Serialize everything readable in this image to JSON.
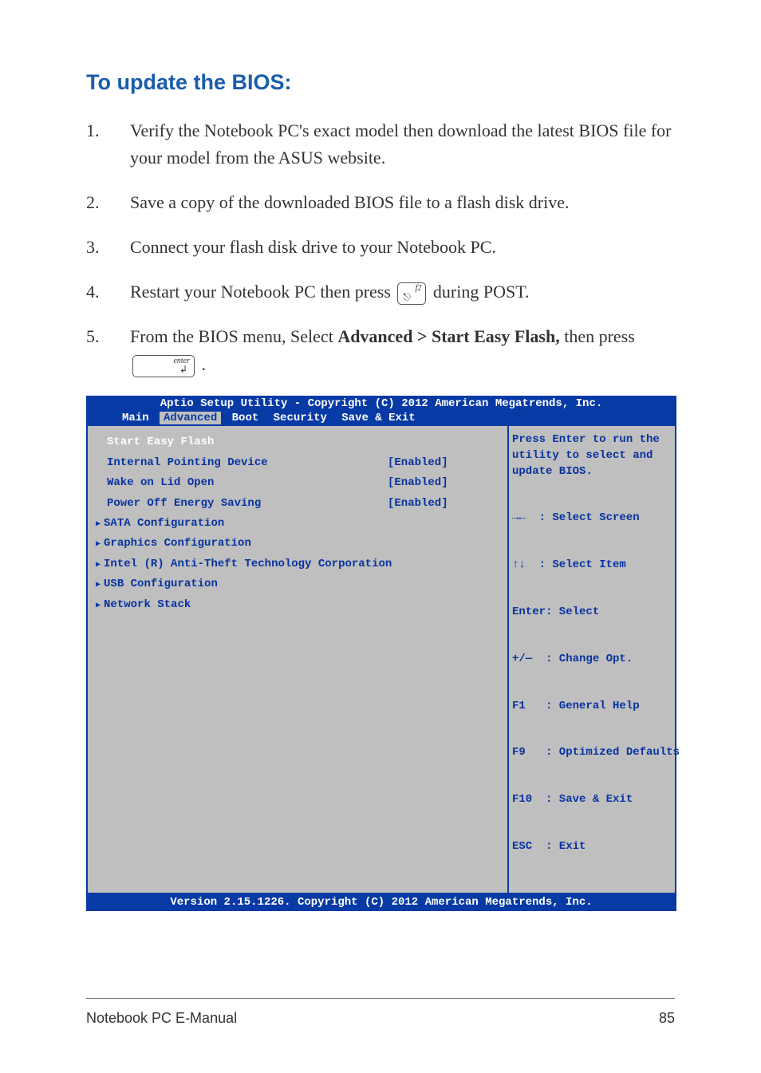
{
  "heading": "To update the BIOS:",
  "steps": {
    "s1": {
      "num": "1.",
      "text": "Verify the Notebook PC's exact model then download the latest BIOS file for your model from the ASUS website."
    },
    "s2": {
      "num": "2.",
      "text": "Save a copy of the downloaded BIOS file to a flash disk drive."
    },
    "s3": {
      "num": "3.",
      "text": "Connect your flash disk drive to your Notebook PC."
    },
    "s4": {
      "num": "4.",
      "pre": "Restart your Notebook PC then press ",
      "post": " during POST."
    },
    "s5": {
      "num": "5.",
      "pre": "From the BIOS menu, Select ",
      "bold": "Advanced > Start Easy Flash,",
      "mid": " then press ",
      "post": "."
    }
  },
  "key_f2_label": "f2",
  "key_f2_sym": "📶",
  "key_enter_label": "enter",
  "key_enter_sym": "↵",
  "bios": {
    "header": "Aptio Setup Utility - Copyright (C) 2012 American Megatrends, Inc.",
    "tabs": [
      "Main",
      "Advanced",
      "Boot",
      "Security",
      "Save & Exit"
    ],
    "active_tab_index": 1,
    "rows": [
      {
        "label": "Start Easy Flash",
        "value": "",
        "selected": true,
        "arrow": false
      },
      {
        "label": "Internal Pointing Device",
        "value": "[Enabled]",
        "selected": false,
        "arrow": false
      },
      {
        "label": "Wake on Lid Open",
        "value": "[Enabled]",
        "selected": false,
        "arrow": false
      },
      {
        "label": "Power Off Energy Saving",
        "value": "[Enabled]",
        "selected": false,
        "arrow": false
      },
      {
        "label": "SATA Configuration",
        "value": "",
        "selected": false,
        "arrow": true
      },
      {
        "label": "Graphics Configuration",
        "value": "",
        "selected": false,
        "arrow": true
      },
      {
        "label": "Intel (R) Anti-Theft Technology Corporation",
        "value": "",
        "selected": false,
        "arrow": true
      },
      {
        "label": "USB Configuration",
        "value": "",
        "selected": false,
        "arrow": true
      },
      {
        "label": "Network Stack",
        "value": "",
        "selected": false,
        "arrow": true
      }
    ],
    "help_top": "Press Enter to run the utility to select and update BIOS.",
    "nav": {
      "l1": "→←  : Select Screen",
      "l2": "↑↓  : Select Item",
      "l3": "Enter: Select",
      "l4": "+/—  : Change Opt.",
      "l5": "F1   : General Help",
      "l6": "F9   : Optimized Defaults",
      "l7": "F10  : Save & Exit",
      "l8": "ESC  : Exit"
    },
    "footer": "Version 2.15.1226. Copyright (C) 2012 American Megatrends, Inc."
  },
  "footer": {
    "title": "Notebook PC E-Manual",
    "page": "85"
  }
}
